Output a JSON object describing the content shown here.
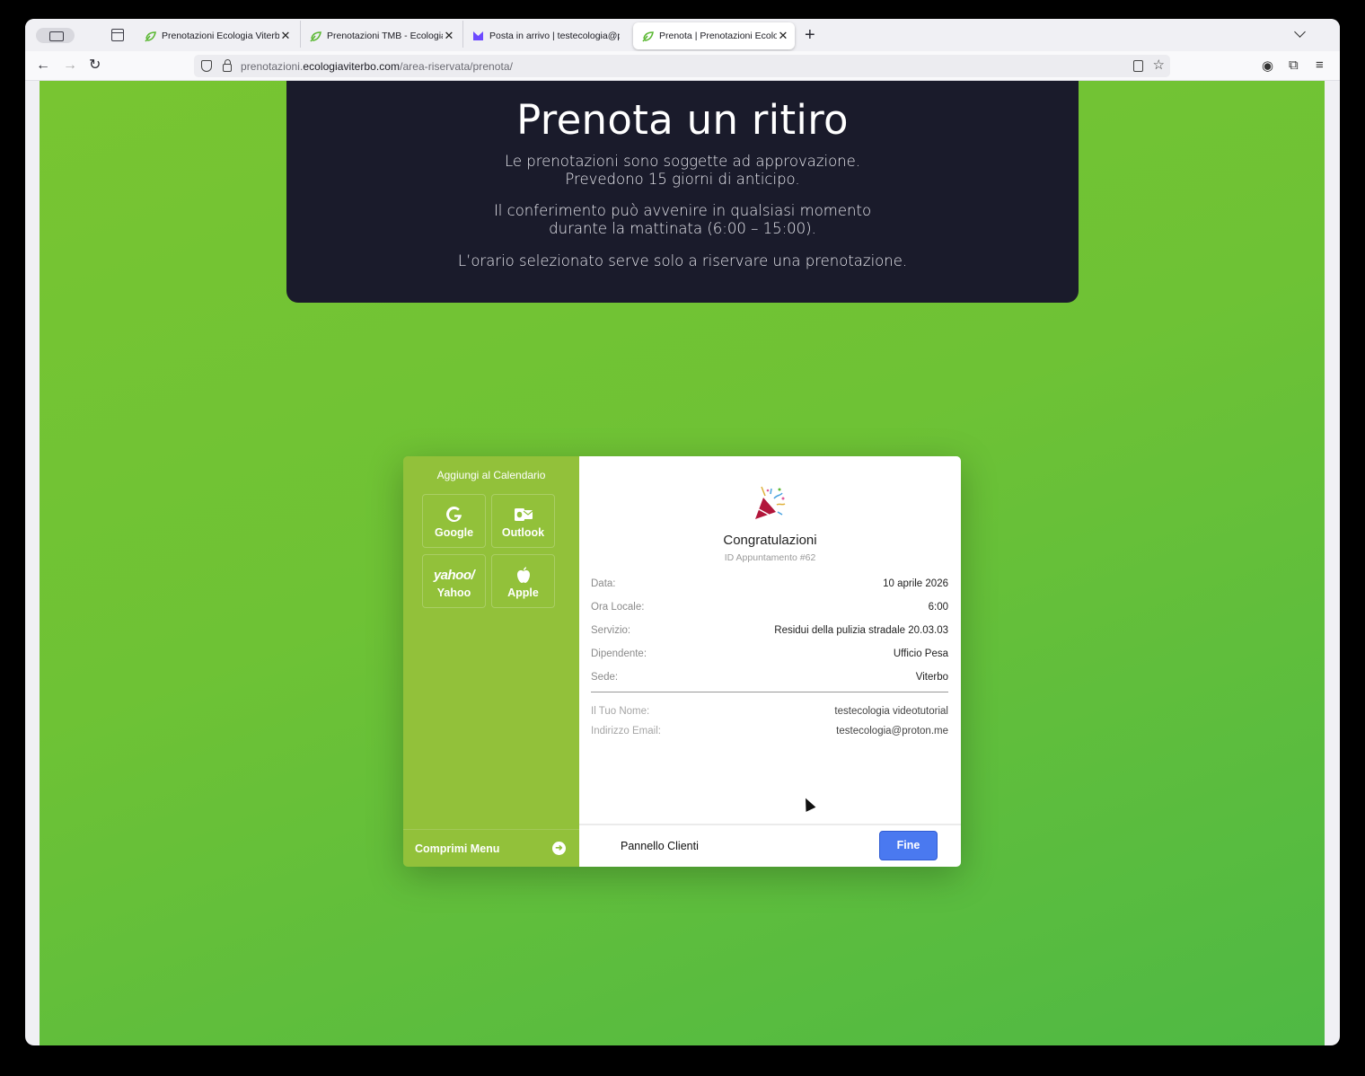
{
  "tabs": [
    {
      "title": "Prenotazioni Ecologia Viterbo | G",
      "favicon": "ecologia-leaf-icon",
      "active": false
    },
    {
      "title": "Prenotazioni TMB - Ecologia Vit",
      "favicon": "ecologia-leaf-icon",
      "active": false
    },
    {
      "title": "Posta in arrivo | testecologia@pr",
      "favicon": "proton-mail-icon",
      "active": false
    },
    {
      "title": "Prenota | Prenotazioni Ecologia V",
      "favicon": "ecologia-leaf-icon",
      "active": true
    }
  ],
  "address_bar": {
    "url_prefix": "prenotazioni.",
    "url_domain": "ecologiaviterbo.com",
    "url_path": "/area-riservata/prenota/"
  },
  "hero": {
    "title": "Prenota un ritiro",
    "line1": "Le prenotazioni sono soggette ad approvazione.",
    "line2": "Prevedono 15 giorni di anticipo.",
    "line3": "Il conferimento può avvenire in qualsiasi momento",
    "line4": "durante la mattinata (6:00 – 15:00).",
    "line5": "L’orario selezionato serve solo a riservare una prenotazione."
  },
  "calendar_panel": {
    "title": "Aggiungi al Calendario",
    "buttons": [
      {
        "label": "Google",
        "icon": "google-icon"
      },
      {
        "label": "Outlook",
        "icon": "outlook-icon"
      },
      {
        "label": "Yahoo",
        "icon": "yahoo-icon"
      },
      {
        "label": "Apple",
        "icon": "apple-icon"
      }
    ],
    "collapse_label": "Comprimi Menu"
  },
  "confirmation": {
    "heading": "Congratulazioni",
    "appointment_id": "ID Appuntamento #62",
    "details": [
      {
        "key": "Data:",
        "value": "10 aprile 2026"
      },
      {
        "key": "Ora Locale:",
        "value": "6:00"
      },
      {
        "key": "Servizio:",
        "value": "Residui della pulizia stradale 20.03.03"
      },
      {
        "key": "Dipendente:",
        "value": "Ufficio Pesa"
      },
      {
        "key": "Sede:",
        "value": "Viterbo"
      }
    ],
    "customer": [
      {
        "key": "Il Tuo Nome:",
        "value": "testecologia videotutorial"
      },
      {
        "key": "Indirizzo Email:",
        "value": "testecologia@proton.me"
      }
    ],
    "panel_link": "Pannello Clienti",
    "done_button": "Fine"
  },
  "colors": {
    "page_green": "#6ec235",
    "hero_dark": "#1a1b2b",
    "side_green": "#92c13a",
    "primary_blue": "#4a79f0"
  }
}
